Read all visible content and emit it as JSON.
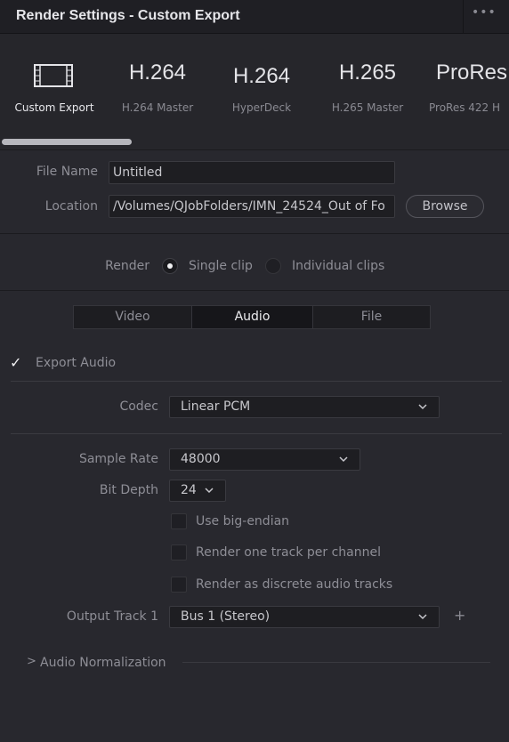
{
  "header": {
    "title": "Render Settings - Custom Export",
    "more": "•••"
  },
  "presets": [
    {
      "big": "",
      "small": "Custom Export",
      "icon": "film-icon"
    },
    {
      "big": "H.264",
      "small": "H.264 Master"
    },
    {
      "big": "H.264",
      "small": "HyperDeck"
    },
    {
      "big": "H.265",
      "small": "H.265 Master"
    },
    {
      "big": "ProRes",
      "small": "ProRes 422 H"
    }
  ],
  "file": {
    "name_label": "File Name",
    "name_value": "Untitled",
    "location_label": "Location",
    "location_value": "/Volumes/QJobFolders/IMN_24524_Out of Fo",
    "browse_label": "Browse"
  },
  "render": {
    "label": "Render",
    "single_clip": "Single clip",
    "individual_clips": "Individual clips",
    "selected": "Single clip"
  },
  "tabs": [
    "Video",
    "Audio",
    "File"
  ],
  "active_tab": "Audio",
  "audio": {
    "export_label": "Export Audio",
    "export_checked": true,
    "codec_label": "Codec",
    "codec_value": "Linear PCM",
    "sample_rate_label": "Sample Rate",
    "sample_rate_value": "48000",
    "bit_depth_label": "Bit Depth",
    "bit_depth_value": "24",
    "big_endian": "Use big-endian",
    "one_track": "Render one track per channel",
    "discrete": "Render as discrete audio tracks",
    "output_track_label": "Output Track 1",
    "output_track_value": "Bus 1 (Stereo)",
    "normalization": "Audio Normalization"
  },
  "colors": {
    "background": "#28282e",
    "header": "#1f1f24",
    "text_active": "#ececef",
    "text_muted": "#8e8e96"
  }
}
